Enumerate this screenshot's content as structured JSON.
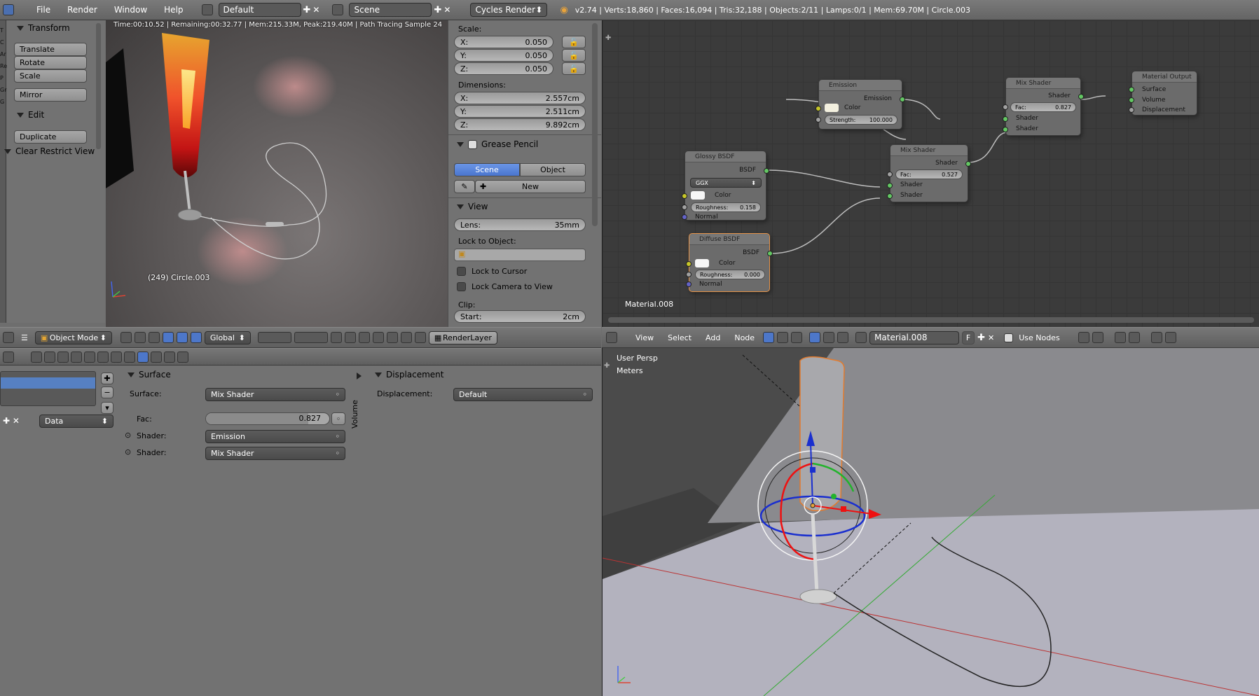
{
  "topbar": {
    "menus": [
      "File",
      "Render",
      "Window",
      "Help"
    ],
    "layout": "Default",
    "scene": "Scene",
    "engine": "Cycles Render",
    "stats": "v2.74 | Verts:18,860 | Faces:16,094 | Tris:32,188 | Objects:2/11 | Lamps:0/1 | Mem:69.70M | Circle.003"
  },
  "toolshelf": {
    "tabs": [
      "T",
      "C",
      "Ar",
      "Re",
      "P",
      "Gre",
      "G"
    ],
    "transform_title": "Transform",
    "translate": "Translate",
    "rotate": "Rotate",
    "scale": "Scale",
    "mirror": "Mirror",
    "edit_title": "Edit",
    "duplicate": "Duplicate",
    "clear_restrict": "Clear Restrict View"
  },
  "render_view": {
    "status": "Time:00:10.52 | Remaining:00:32.77 | Mem:215.33M, Peak:219.40M | Path Tracing Sample 24",
    "object_label": "(249) Circle.003"
  },
  "properties_n": {
    "scale_title": "Scale:",
    "scale": [
      {
        "axis": "X:",
        "value": "0.050"
      },
      {
        "axis": "Y:",
        "value": "0.050"
      },
      {
        "axis": "Z:",
        "value": "0.050"
      }
    ],
    "dimensions_title": "Dimensions:",
    "dimensions": [
      {
        "axis": "X:",
        "value": "2.557cm"
      },
      {
        "axis": "Y:",
        "value": "2.511cm"
      },
      {
        "axis": "Z:",
        "value": "9.892cm"
      }
    ],
    "grease_title": "Grease Pencil",
    "scene_btn": "Scene",
    "object_btn": "Object",
    "new_btn": "New",
    "view_title": "View",
    "lens_label": "Lens:",
    "lens_value": "35mm",
    "lock_object": "Lock to Object:",
    "lock_cursor": "Lock to Cursor",
    "lock_camera": "Lock Camera to View",
    "clip_title": "Clip:",
    "start_label": "Start:",
    "start_value": "2cm"
  },
  "viewport_header": {
    "mode": "Object Mode",
    "orientation": "Global",
    "render_layer": "RenderLayer"
  },
  "node_editor": {
    "material_label": "Material.008",
    "header_menus": [
      "View",
      "Select",
      "Add",
      "Node"
    ],
    "material_name": "Material.008",
    "fake_user": "F",
    "use_nodes": "Use Nodes",
    "nodes": {
      "emission": {
        "title": "Emission",
        "out": "Emission",
        "color": "Color",
        "strength": "Strength:",
        "strength_value": "100.000"
      },
      "mix1": {
        "title": "Mix Shader",
        "out": "Shader",
        "fac": "Fac:",
        "fac_value": "0.827",
        "in1": "Shader",
        "in2": "Shader"
      },
      "output": {
        "title": "Material Output",
        "surface": "Surface",
        "volume": "Volume",
        "displacement": "Displacement"
      },
      "glossy": {
        "title": "Glossy BSDF",
        "out": "BSDF",
        "dist": "GGX",
        "color": "Color",
        "roughness": "Roughness:",
        "roughness_value": "0.158",
        "normal": "Normal"
      },
      "mix2": {
        "title": "Mix Shader",
        "out": "Shader",
        "fac": "Fac:",
        "fac_value": "0.527",
        "in1": "Shader",
        "in2": "Shader"
      },
      "diffuse": {
        "title": "Diffuse BSDF",
        "out": "BSDF",
        "color": "Color",
        "roughness": "Roughness:",
        "roughness_value": "0.000",
        "normal": "Normal"
      }
    }
  },
  "material_props": {
    "data_dropdown": "Data",
    "surface_title": "Surface",
    "surface_label": "Surface:",
    "surface_value": "Mix Shader",
    "fac_label": "Fac:",
    "fac_value": "0.827",
    "fac_fraction": 0.827,
    "shader1_label": "Shader:",
    "shader1_value": "Emission",
    "shader2_label": "Shader:",
    "shader2_value": "Mix Shader",
    "volume_tab": "Volume",
    "displacement_title": "Displacement",
    "displacement_label": "Displacement:",
    "displacement_value": "Default"
  },
  "viewport3d": {
    "view_name": "User Persp",
    "units": "Meters"
  }
}
